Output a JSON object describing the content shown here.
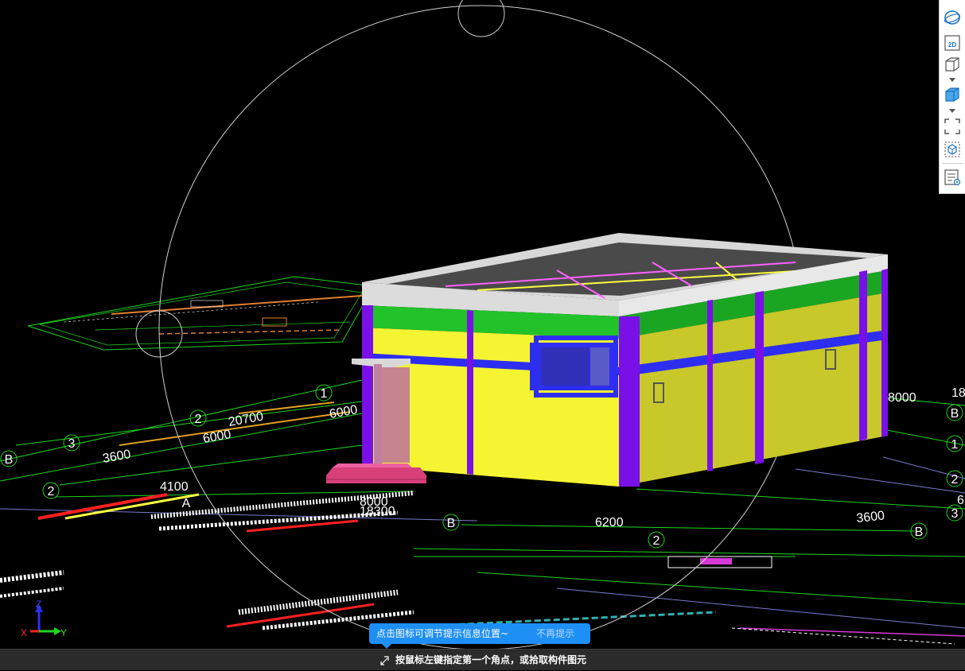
{
  "viewport": {
    "grid_labels": {
      "left_b": "B",
      "left_3": "3",
      "left_2_upper": "2",
      "left_1": "1",
      "left_2_lower": "2",
      "left_a": "A",
      "front_b": "B",
      "front_2": "2",
      "right_b_top": "B",
      "right_1": "1",
      "right_2": "2",
      "right_3": "3",
      "right_b_bottom": "B"
    },
    "dimensions": {
      "d20700": "20700",
      "d6000_a": "6000",
      "d6000_b": "6000",
      "d3600_left": "3600",
      "d4100": "4100",
      "d8000_front": "8000",
      "d18300": "18300",
      "d6200": "6200",
      "d3600_right": "3600",
      "d8000_right": "8000",
      "d18_right": "18",
      "d6_right": "6"
    },
    "axes": {
      "z": "Z",
      "x": "X",
      "y": "Y"
    },
    "colors": {
      "wall": "#f4f433",
      "wall_side": "#c8c82a",
      "column": "#7a10e8",
      "beam": "#2e2ef0",
      "band": "#22c22a",
      "roof": "#d8d8d8",
      "grid": "#1fd61f",
      "stairs": "#d8407a"
    }
  },
  "toolbar": {
    "items": [
      {
        "name": "orbit-icon"
      },
      {
        "name": "view-2d-icon",
        "label": "2D"
      },
      {
        "name": "view-3d-box-icon"
      },
      {
        "name": "view-3d-solid-icon"
      },
      {
        "name": "zoom-extents-icon"
      },
      {
        "name": "section-box-icon"
      },
      {
        "name": "properties-panel-icon"
      }
    ]
  },
  "tooltip": {
    "text": "点击图标可调节提示信息位置~",
    "dismiss": "不再提示"
  },
  "status": {
    "icon": "cursor-corner-icon",
    "text": "按鼠标左键指定第一个角点，或拾取构件图元"
  }
}
